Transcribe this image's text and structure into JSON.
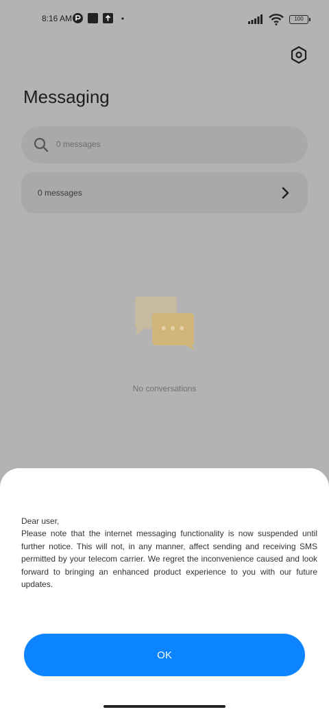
{
  "status_bar": {
    "time": "8:16 AM",
    "battery": "100"
  },
  "header": {
    "title": "Messaging"
  },
  "search": {
    "placeholder": "0  messages"
  },
  "messages_row": {
    "label": "0  messages"
  },
  "empty_state": {
    "text": "No  conversations"
  },
  "dialog": {
    "greeting": "Dear user,",
    "message": "Please note that the internet messaging functionality is now suspended until further notice. This will not, in any manner, affect sending and receiving SMS permitted by your telecom carrier. We regret the inconvenience caused and look forward to bringing an enhanced product experience to you with our future updates.",
    "ok_label": "OK"
  },
  "colors": {
    "overlay": "#b3b3b3",
    "accent": "#0d84ff",
    "sheet": "#ffffff"
  }
}
